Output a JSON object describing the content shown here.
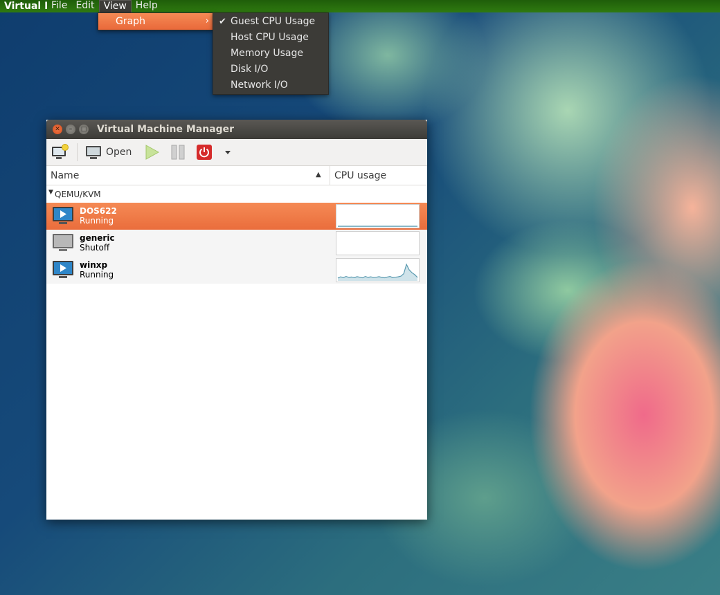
{
  "menubar": {
    "app_name": "Virtual M",
    "items": [
      "File",
      "Edit",
      "View",
      "Help"
    ]
  },
  "view_menu": {
    "items": [
      "Graph"
    ]
  },
  "graph_menu": {
    "items": [
      {
        "label": "Guest CPU Usage",
        "checked": true
      },
      {
        "label": "Host CPU Usage",
        "checked": false
      },
      {
        "label": "Memory Usage",
        "checked": false
      },
      {
        "label": "Disk I/O",
        "checked": false
      },
      {
        "label": "Network I/O",
        "checked": false
      }
    ]
  },
  "window": {
    "title": "Virtual Machine Manager",
    "toolbar": {
      "open_label": "Open"
    },
    "columns": {
      "name": "Name",
      "cpu": "CPU usage"
    },
    "group": "QEMU/KVM",
    "vms": [
      {
        "name": "DOS622",
        "state": "Running",
        "selected": true,
        "cpu": [
          0,
          0,
          0,
          0,
          0,
          0,
          0,
          0,
          0,
          0,
          0,
          0,
          0,
          0,
          0,
          0,
          0,
          0,
          0,
          0,
          0,
          0,
          0,
          0,
          0,
          0,
          0,
          0,
          0,
          0
        ]
      },
      {
        "name": "generic",
        "state": "Shutoff",
        "selected": false,
        "cpu": []
      },
      {
        "name": "winxp",
        "state": "Running",
        "selected": false,
        "cpu": [
          0.12,
          0.18,
          0.14,
          0.2,
          0.15,
          0.17,
          0.14,
          0.19,
          0.16,
          0.13,
          0.2,
          0.15,
          0.18,
          0.14,
          0.16,
          0.19,
          0.15,
          0.13,
          0.17,
          0.2,
          0.14,
          0.16,
          0.18,
          0.22,
          0.35,
          0.85,
          0.55,
          0.4,
          0.3,
          0.15
        ]
      }
    ]
  },
  "colors": {
    "accent": "#ea6d3c",
    "menu_bg": "#3c3b37",
    "spark_line": "#5a9ab0",
    "spark_fill": "#cfe3ea"
  }
}
